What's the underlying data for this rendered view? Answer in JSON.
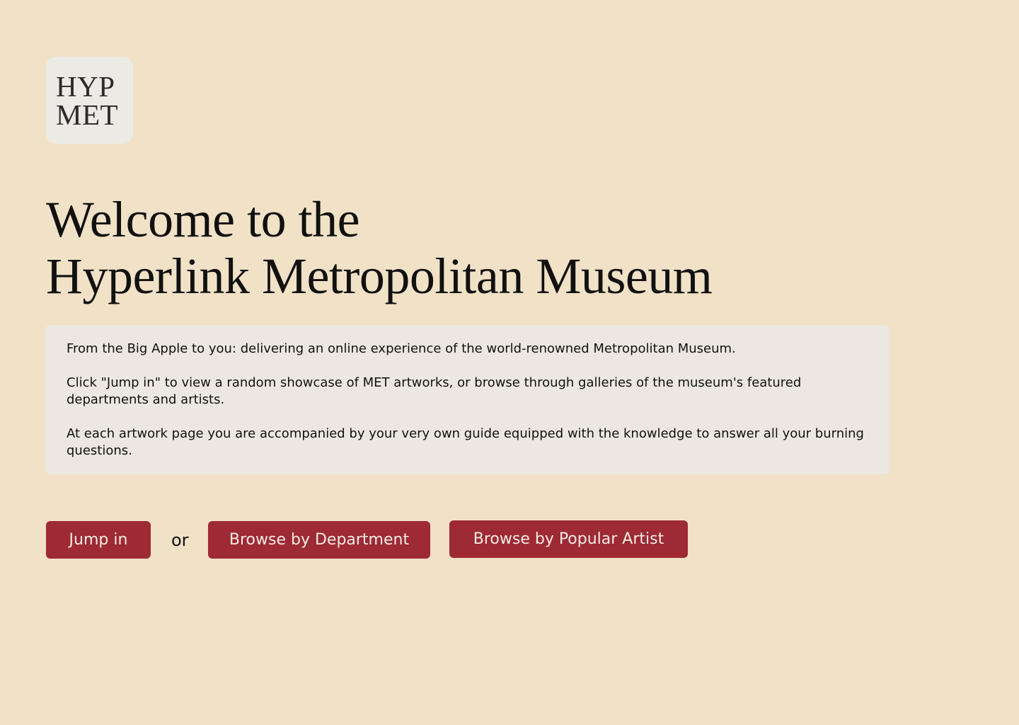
{
  "logo": {
    "line1": "HYP",
    "line2": "MET"
  },
  "headline": {
    "line1": "Welcome to the",
    "line2": "Hyperlink Metropolitan Museum"
  },
  "intro": {
    "paragraphs": [
      "From the Big Apple to you: delivering an online experience of the world-renowned Metropolitan Museum.",
      "Click \"Jump in\" to view a random showcase of MET artworks, or browse through galleries of the museum's featured departments and artists.",
      "At each artwork page you are accompanied by your very own guide equipped with the knowledge to answer all your burning questions."
    ]
  },
  "actions": {
    "jump_in_label": "Jump in",
    "or_label": "or",
    "browse_department_label": "Browse by Department",
    "browse_artist_label": "Browse by Popular Artist"
  },
  "colors": {
    "background": "#f1e1c6",
    "panel": "#ece8e1",
    "accent": "#9e2a35"
  }
}
